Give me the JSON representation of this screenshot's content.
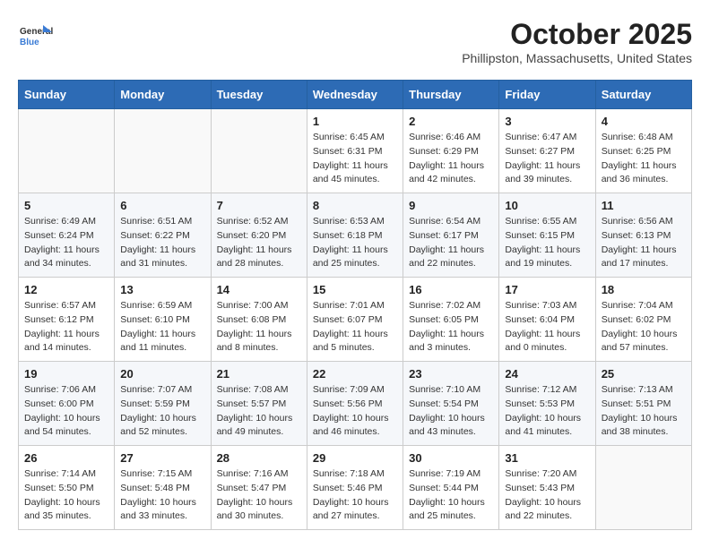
{
  "header": {
    "logo_general": "General",
    "logo_blue": "Blue",
    "title": "October 2025",
    "subtitle": "Phillipston, Massachusetts, United States"
  },
  "weekdays": [
    "Sunday",
    "Monday",
    "Tuesday",
    "Wednesday",
    "Thursday",
    "Friday",
    "Saturday"
  ],
  "weeks": [
    [
      {
        "day": "",
        "info": ""
      },
      {
        "day": "",
        "info": ""
      },
      {
        "day": "",
        "info": ""
      },
      {
        "day": "1",
        "info": "Sunrise: 6:45 AM\nSunset: 6:31 PM\nDaylight: 11 hours\nand 45 minutes."
      },
      {
        "day": "2",
        "info": "Sunrise: 6:46 AM\nSunset: 6:29 PM\nDaylight: 11 hours\nand 42 minutes."
      },
      {
        "day": "3",
        "info": "Sunrise: 6:47 AM\nSunset: 6:27 PM\nDaylight: 11 hours\nand 39 minutes."
      },
      {
        "day": "4",
        "info": "Sunrise: 6:48 AM\nSunset: 6:25 PM\nDaylight: 11 hours\nand 36 minutes."
      }
    ],
    [
      {
        "day": "5",
        "info": "Sunrise: 6:49 AM\nSunset: 6:24 PM\nDaylight: 11 hours\nand 34 minutes."
      },
      {
        "day": "6",
        "info": "Sunrise: 6:51 AM\nSunset: 6:22 PM\nDaylight: 11 hours\nand 31 minutes."
      },
      {
        "day": "7",
        "info": "Sunrise: 6:52 AM\nSunset: 6:20 PM\nDaylight: 11 hours\nand 28 minutes."
      },
      {
        "day": "8",
        "info": "Sunrise: 6:53 AM\nSunset: 6:18 PM\nDaylight: 11 hours\nand 25 minutes."
      },
      {
        "day": "9",
        "info": "Sunrise: 6:54 AM\nSunset: 6:17 PM\nDaylight: 11 hours\nand 22 minutes."
      },
      {
        "day": "10",
        "info": "Sunrise: 6:55 AM\nSunset: 6:15 PM\nDaylight: 11 hours\nand 19 minutes."
      },
      {
        "day": "11",
        "info": "Sunrise: 6:56 AM\nSunset: 6:13 PM\nDaylight: 11 hours\nand 17 minutes."
      }
    ],
    [
      {
        "day": "12",
        "info": "Sunrise: 6:57 AM\nSunset: 6:12 PM\nDaylight: 11 hours\nand 14 minutes."
      },
      {
        "day": "13",
        "info": "Sunrise: 6:59 AM\nSunset: 6:10 PM\nDaylight: 11 hours\nand 11 minutes."
      },
      {
        "day": "14",
        "info": "Sunrise: 7:00 AM\nSunset: 6:08 PM\nDaylight: 11 hours\nand 8 minutes."
      },
      {
        "day": "15",
        "info": "Sunrise: 7:01 AM\nSunset: 6:07 PM\nDaylight: 11 hours\nand 5 minutes."
      },
      {
        "day": "16",
        "info": "Sunrise: 7:02 AM\nSunset: 6:05 PM\nDaylight: 11 hours\nand 3 minutes."
      },
      {
        "day": "17",
        "info": "Sunrise: 7:03 AM\nSunset: 6:04 PM\nDaylight: 11 hours\nand 0 minutes."
      },
      {
        "day": "18",
        "info": "Sunrise: 7:04 AM\nSunset: 6:02 PM\nDaylight: 10 hours\nand 57 minutes."
      }
    ],
    [
      {
        "day": "19",
        "info": "Sunrise: 7:06 AM\nSunset: 6:00 PM\nDaylight: 10 hours\nand 54 minutes."
      },
      {
        "day": "20",
        "info": "Sunrise: 7:07 AM\nSunset: 5:59 PM\nDaylight: 10 hours\nand 52 minutes."
      },
      {
        "day": "21",
        "info": "Sunrise: 7:08 AM\nSunset: 5:57 PM\nDaylight: 10 hours\nand 49 minutes."
      },
      {
        "day": "22",
        "info": "Sunrise: 7:09 AM\nSunset: 5:56 PM\nDaylight: 10 hours\nand 46 minutes."
      },
      {
        "day": "23",
        "info": "Sunrise: 7:10 AM\nSunset: 5:54 PM\nDaylight: 10 hours\nand 43 minutes."
      },
      {
        "day": "24",
        "info": "Sunrise: 7:12 AM\nSunset: 5:53 PM\nDaylight: 10 hours\nand 41 minutes."
      },
      {
        "day": "25",
        "info": "Sunrise: 7:13 AM\nSunset: 5:51 PM\nDaylight: 10 hours\nand 38 minutes."
      }
    ],
    [
      {
        "day": "26",
        "info": "Sunrise: 7:14 AM\nSunset: 5:50 PM\nDaylight: 10 hours\nand 35 minutes."
      },
      {
        "day": "27",
        "info": "Sunrise: 7:15 AM\nSunset: 5:48 PM\nDaylight: 10 hours\nand 33 minutes."
      },
      {
        "day": "28",
        "info": "Sunrise: 7:16 AM\nSunset: 5:47 PM\nDaylight: 10 hours\nand 30 minutes."
      },
      {
        "day": "29",
        "info": "Sunrise: 7:18 AM\nSunset: 5:46 PM\nDaylight: 10 hours\nand 27 minutes."
      },
      {
        "day": "30",
        "info": "Sunrise: 7:19 AM\nSunset: 5:44 PM\nDaylight: 10 hours\nand 25 minutes."
      },
      {
        "day": "31",
        "info": "Sunrise: 7:20 AM\nSunset: 5:43 PM\nDaylight: 10 hours\nand 22 minutes."
      },
      {
        "day": "",
        "info": ""
      }
    ]
  ]
}
